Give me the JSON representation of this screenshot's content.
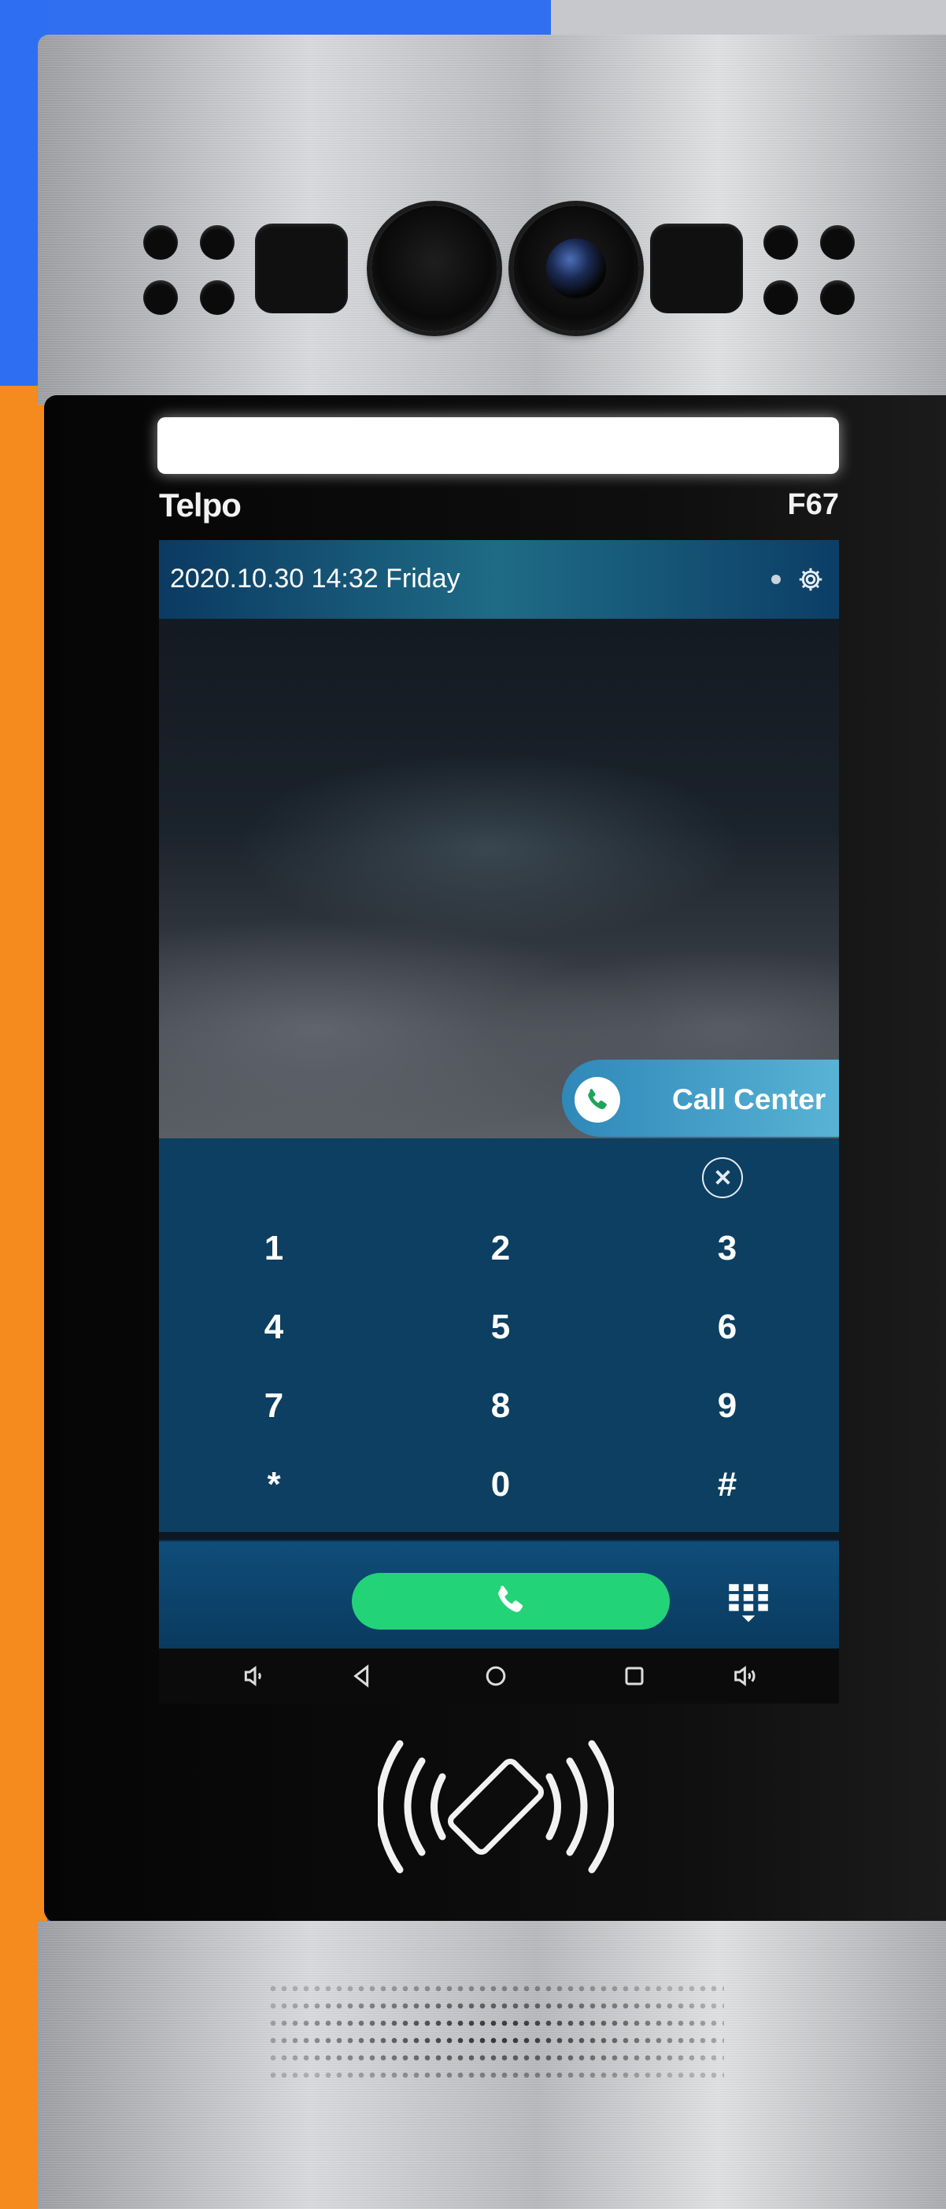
{
  "device": {
    "brand": "Telpo",
    "model": "F67"
  },
  "status_bar": {
    "datetime": "2020.10.30 14:32 Friday",
    "settings_icon": "gear-icon"
  },
  "call_center": {
    "label": "Call Center",
    "icon": "phone-icon"
  },
  "keypad": {
    "keys": [
      "1",
      "2",
      "3",
      "4",
      "5",
      "6",
      "7",
      "8",
      "9",
      "*",
      "0",
      "#"
    ],
    "clear_icon": "circle-x-icon"
  },
  "actions": {
    "dial_icon": "phone-icon",
    "keypad_toggle_icon": "keypad-icon"
  },
  "nav_bar": {
    "items": [
      "volume-down-icon",
      "back-icon",
      "home-icon",
      "recents-icon",
      "volume-up-icon"
    ]
  },
  "colors": {
    "dial_green": "#22d377",
    "keypad_bg": "#0c3f61",
    "call_center_blue": "#4aa6cf"
  }
}
